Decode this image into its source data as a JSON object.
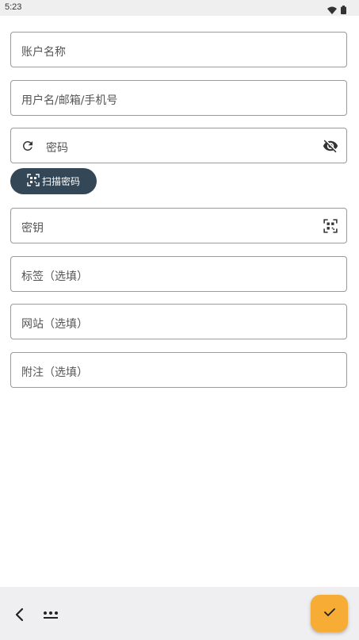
{
  "status_bar": {
    "time": "5:23",
    "icons": [
      "wifi-icon",
      "battery-icon"
    ]
  },
  "form": {
    "account_name_label": "账户名称",
    "username_label": "用户名/邮箱/手机号",
    "password_label": "密码",
    "scan_password_label": "扫描密码",
    "secret_key_label": "密钥",
    "tags_label": "标签（选填）",
    "website_label": "网站（选填）",
    "notes_label": "附注（选填）"
  },
  "colors": {
    "chip_background": "#334756",
    "fab_background": "#f6ac35",
    "bottom_bar": "#efeff1"
  },
  "icons": {
    "refresh": "refresh-icon",
    "toggle_visibility": "eye-off-icon",
    "qr_scan": "qr-scan-icon",
    "back": "back-arrow-icon",
    "more": "more-icon",
    "confirm": "check-icon"
  }
}
